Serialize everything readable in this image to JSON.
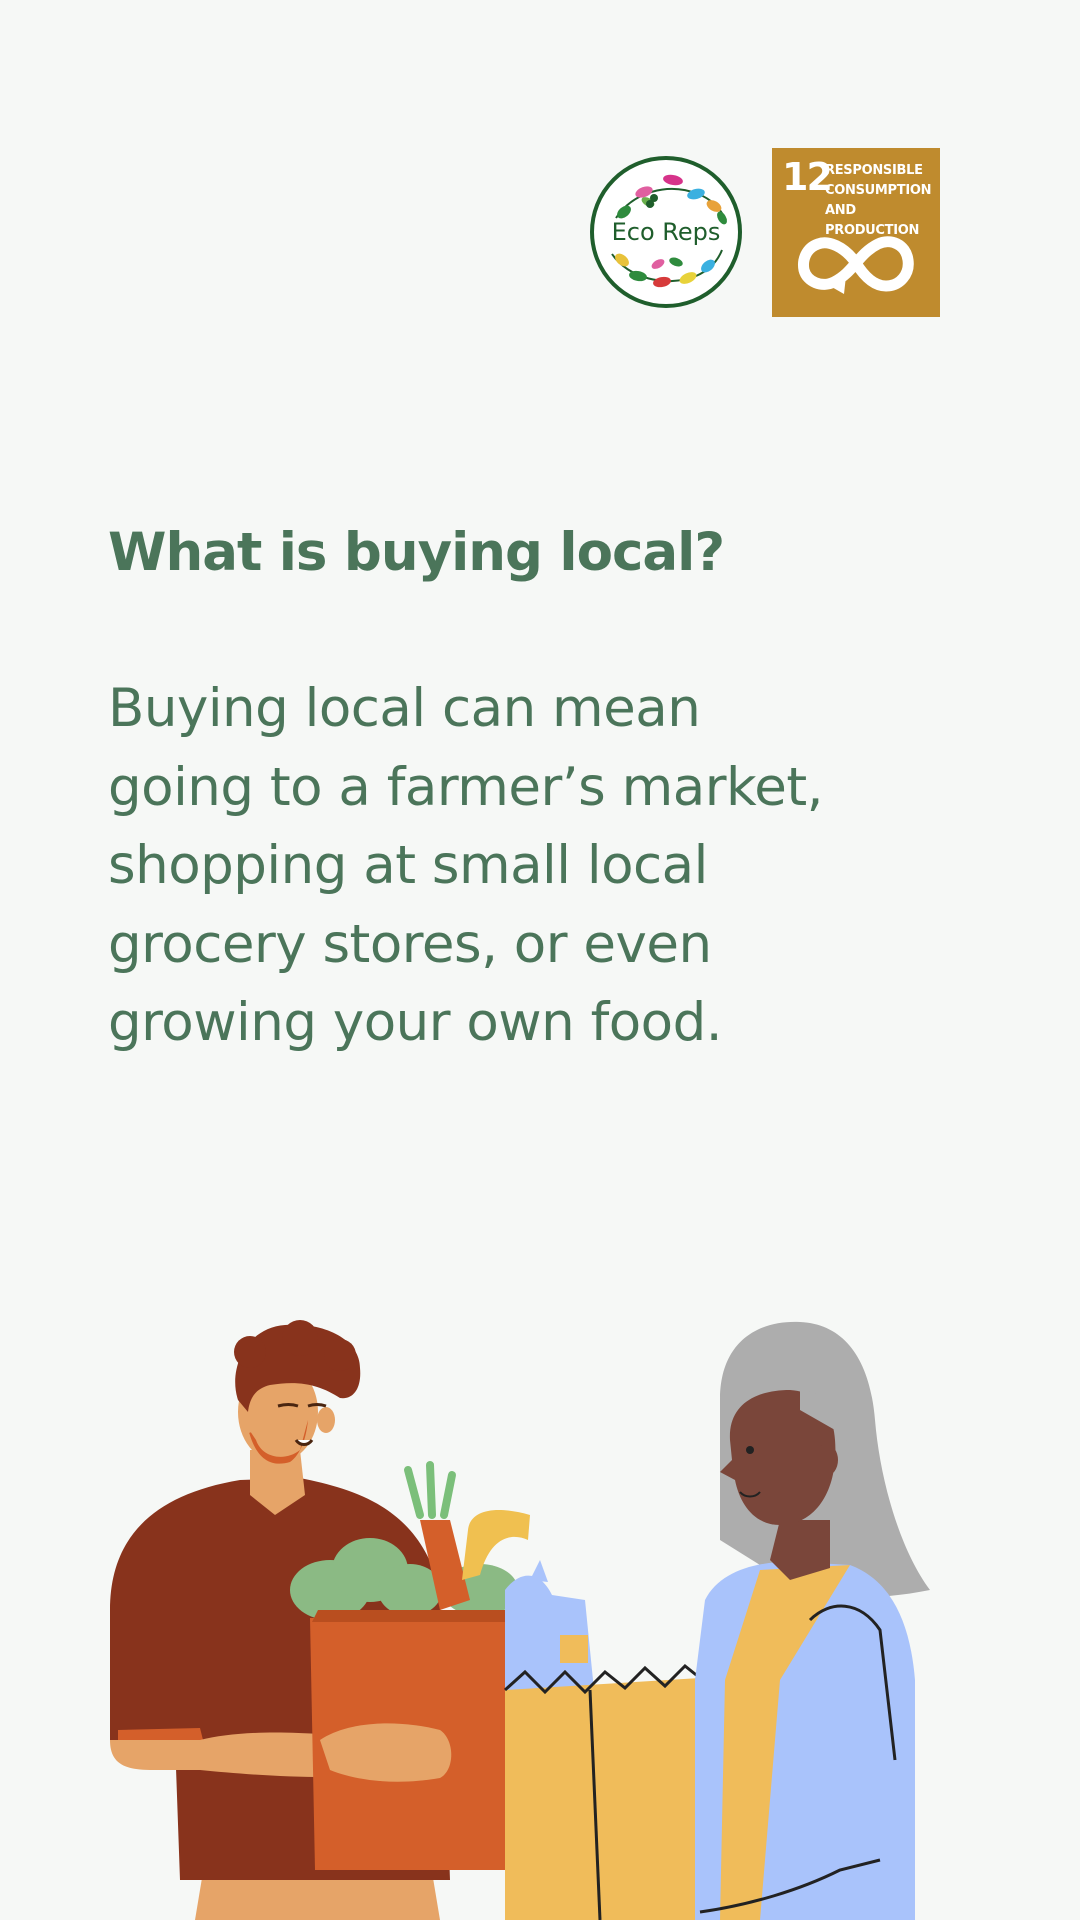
{
  "logos": {
    "eco_reps_text": "Eco Reps",
    "sdg": {
      "number": "12",
      "title": "RESPONSIBLE\nCONSUMPTION\nAND PRODUCTION",
      "color": "#bf8b2e",
      "icon": "infinity-arrow-icon"
    }
  },
  "heading": "What is buying local?",
  "body_lines": [
    "Buying local can mean",
    "going to a farmer’s market,",
    "shopping at small local",
    "grocery stores, or even",
    "growing your own food."
  ],
  "colors": {
    "background": "#f6f8f6",
    "text": "#4b755a",
    "eco_green": "#1f5e2c"
  }
}
